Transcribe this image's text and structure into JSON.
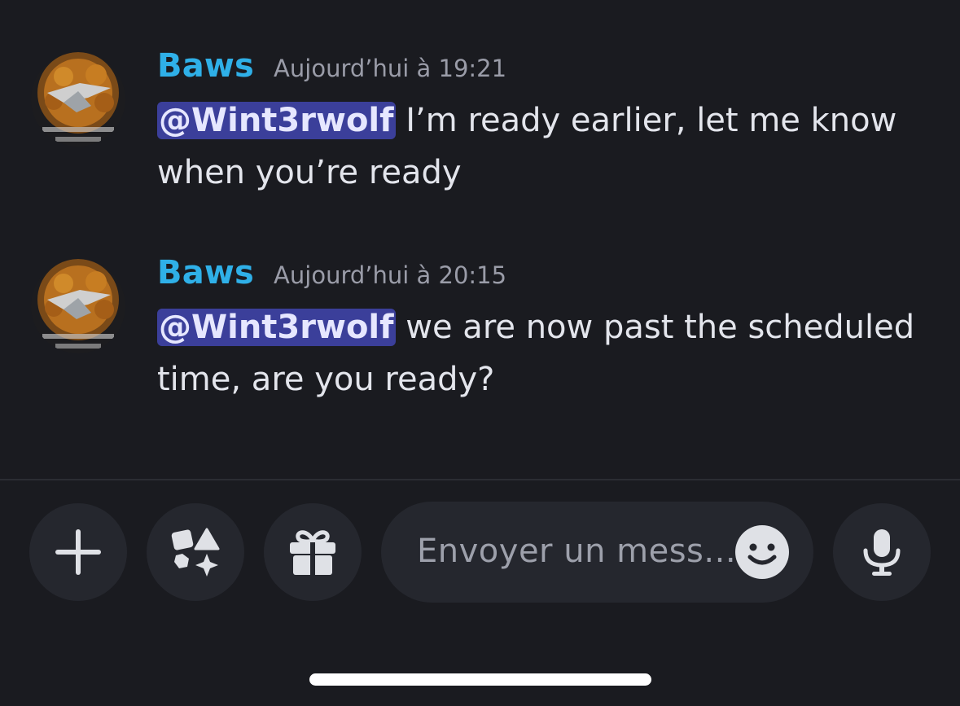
{
  "messages": [
    {
      "author": "Baws",
      "timestamp": "Aujourd’hui à 19:21",
      "mention": "@Wint3rwolf",
      "text_line1": " I’m ready earlier, let me know",
      "text_line2": "when you’re ready"
    },
    {
      "author": "Baws",
      "timestamp": "Aujourd’hui à 20:15",
      "mention": "@Wint3rwolf",
      "text_line1": " we are now past the scheduled",
      "text_line2": "time, are you ready?"
    }
  ],
  "composer": {
    "placeholder": "Envoyer un mess..."
  },
  "icons": {
    "add": "plus-icon",
    "apps": "apps-icon",
    "gift": "gift-icon",
    "emoji": "emoji-icon",
    "mic": "microphone-icon"
  },
  "colors": {
    "background": "#1a1b20",
    "author": "#2fb0e8",
    "mention_bg": "#3b3f9a",
    "button_bg": "#25272e"
  }
}
